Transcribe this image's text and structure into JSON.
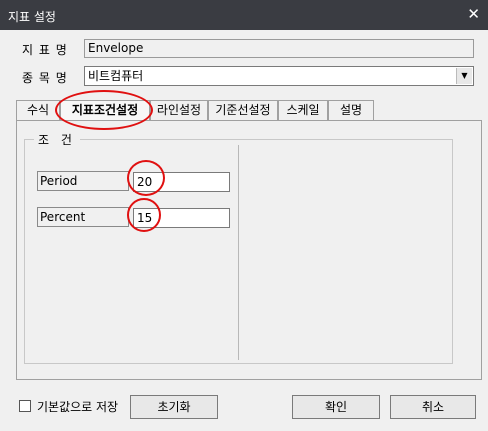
{
  "window": {
    "title": "지표 설정",
    "close_glyph": "✕"
  },
  "form": {
    "indicator_name_label": "지 표 명",
    "indicator_name_value": "Envelope",
    "item_name_label": "종 목 명",
    "item_name_value": "비트컴퓨터"
  },
  "tabs": [
    {
      "label": "수식"
    },
    {
      "label": "지표조건설정"
    },
    {
      "label": "라인설정"
    },
    {
      "label": "기준선설정"
    },
    {
      "label": "스케일"
    },
    {
      "label": "설명"
    }
  ],
  "conditions": {
    "group_title": "조 건",
    "params": [
      {
        "label": "Period",
        "value": "20"
      },
      {
        "label": "Percent",
        "value": "15"
      }
    ]
  },
  "footer": {
    "save_default_label": "기본값으로 저장",
    "reset_label": "초기화",
    "ok_label": "확인",
    "cancel_label": "취소"
  },
  "colors": {
    "annotation_circle": "#e01010",
    "titlebar": "#3a3c42"
  }
}
